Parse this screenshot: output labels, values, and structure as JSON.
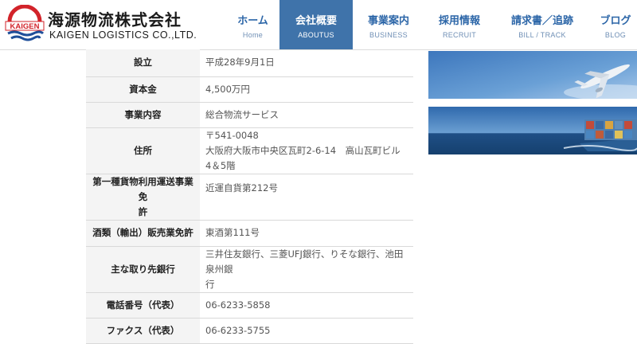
{
  "brand": {
    "logo_badge": "KAIGEN",
    "name_ja": "海源物流株式会社",
    "name_en": "KAIGEN LOGISTICS CO.,LTD.",
    "colors": {
      "red": "#d2232a",
      "blue": "#1f4f9a"
    }
  },
  "nav": {
    "items": [
      {
        "label": "ホーム",
        "sub": "Home",
        "active": false
      },
      {
        "label": "会社概要",
        "sub": "ABOUTUS",
        "active": true
      },
      {
        "label": "事業案内",
        "sub": "BUSINESS",
        "active": false
      },
      {
        "label": "採用情報",
        "sub": "RECRUIT",
        "active": false
      },
      {
        "label": "請求書／追跡",
        "sub": "BILL / TRACK",
        "active": false
      },
      {
        "label": "ブログ",
        "sub": "BLOG",
        "active": false
      }
    ],
    "accent": "#3f73aa"
  },
  "company": {
    "rows": [
      {
        "label": "設立",
        "value": "平成28年9月1日"
      },
      {
        "label": "資本金",
        "value": "4,500万円"
      },
      {
        "label": "事業内容",
        "value": "総合物流サービス"
      },
      {
        "label": "住所",
        "value_line1": "〒541-0048",
        "value_line2": "大阪府大阪市中央区瓦町2-6-14　高山瓦町ビル4＆5階"
      },
      {
        "label_line1": "第一種貨物利用運送事業免",
        "label_line2": "許",
        "value": "近運自貨第212号"
      },
      {
        "label": "酒類（輸出）販売業免許",
        "value": "東酒第111号"
      },
      {
        "label": "主な取り先銀行",
        "value_line1": "三井住友銀行、三菱UFJ銀行、りそな銀行、池田泉州銀",
        "value_line2": "行"
      },
      {
        "label": "電話番号（代表）",
        "value": "06-6233-5858"
      },
      {
        "label": "ファクス（代表）",
        "value": "06-6233-5755"
      }
    ]
  },
  "banners": [
    {
      "icon": "airplane-image"
    },
    {
      "icon": "cargo-ship-image"
    }
  ]
}
